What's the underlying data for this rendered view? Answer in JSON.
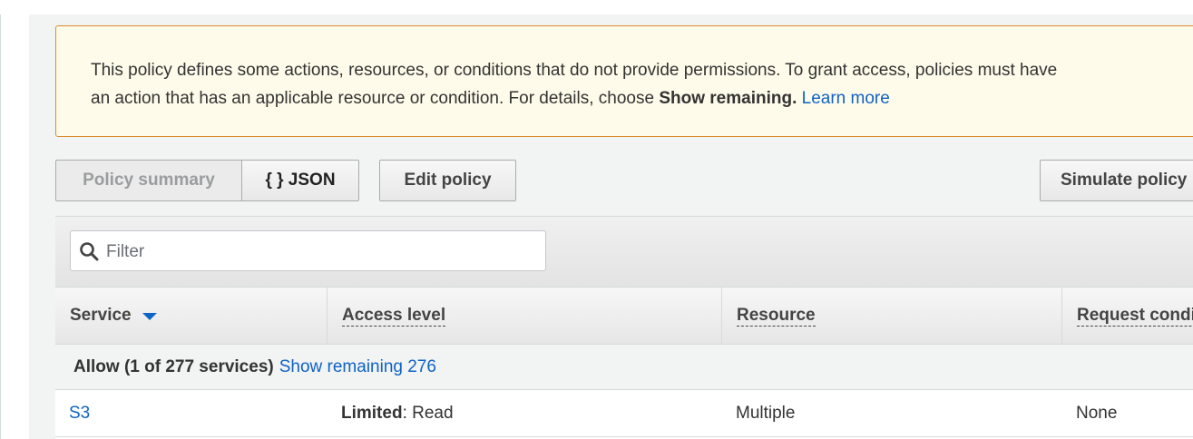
{
  "notice": {
    "text_before": "This policy defines some actions, resources, or conditions that do not provide permissions. To grant access, policies must have",
    "text_line2": "an action that has an applicable resource or condition. For details, choose ",
    "bold_text": "Show remaining.",
    "link_text": "Learn more"
  },
  "toolbar": {
    "summary_label": "Policy summary",
    "json_label": "{ } JSON",
    "edit_label": "Edit policy",
    "simulate_label": "Simulate policy"
  },
  "filter": {
    "placeholder": "Filter"
  },
  "columns": {
    "service": "Service",
    "access_level": "Access level",
    "resource": "Resource",
    "request_condition": "Request condition"
  },
  "group": {
    "label": "Allow (1 of 277 services)",
    "link": "Show remaining 276"
  },
  "rows": [
    {
      "service": "S3",
      "access_bold": "Limited",
      "access_rest": ": Read",
      "resource": "Multiple",
      "request_condition": "None"
    }
  ],
  "colors": {
    "link": "#0f63c5",
    "notice_border": "#dd8a2e",
    "notice_bg": "#fffbea"
  }
}
